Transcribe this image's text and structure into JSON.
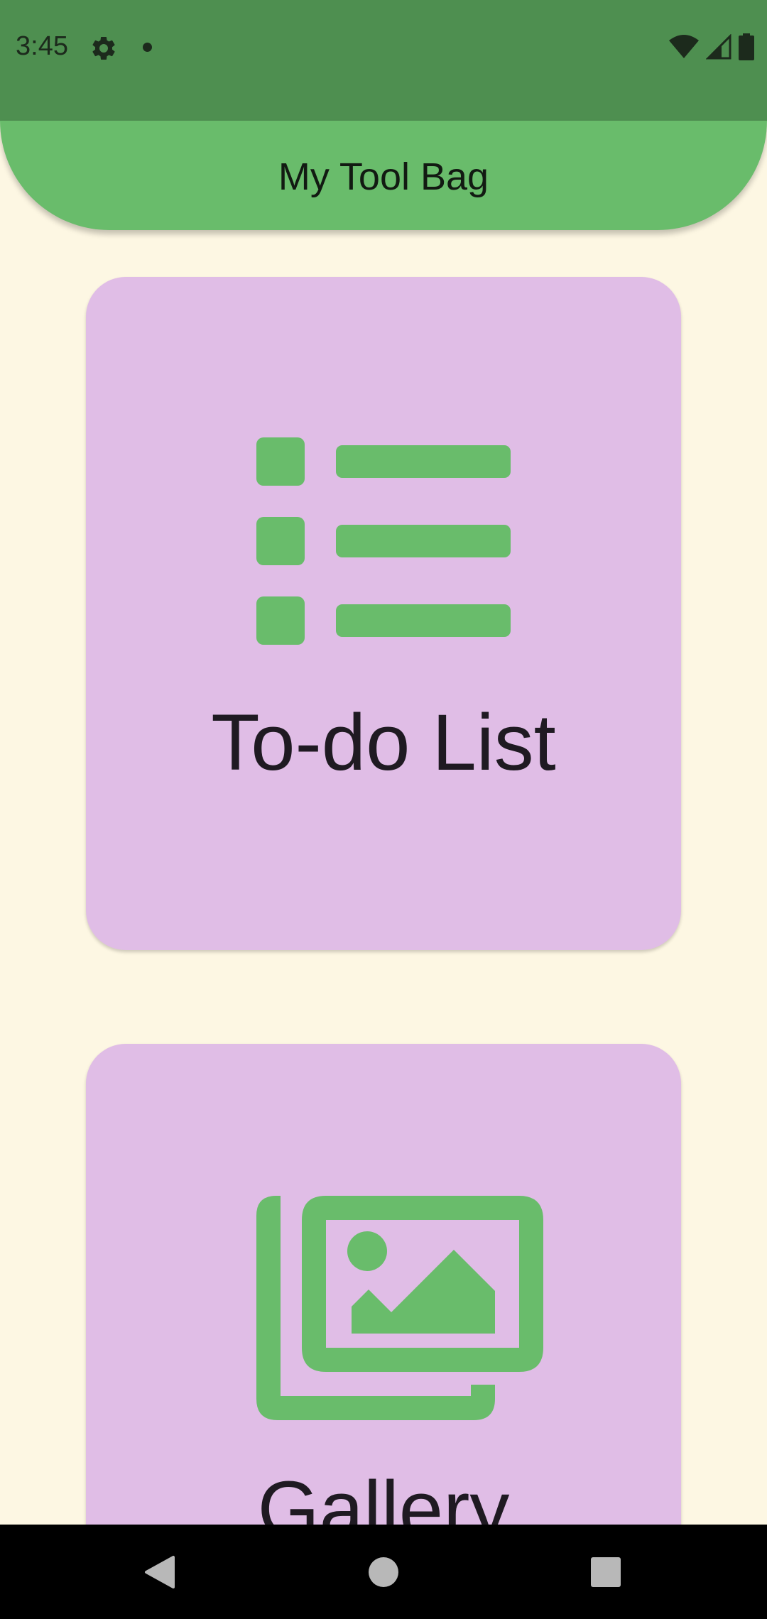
{
  "status_bar": {
    "time": "3:45",
    "settings_icon": "gear-icon",
    "notification_dot": "dot-icon",
    "wifi_icon": "wifi-icon",
    "signal_icon": "cell-signal-icon",
    "battery_icon": "battery-icon"
  },
  "app_bar": {
    "title": "My Tool Bag"
  },
  "cards": [
    {
      "label": "To-do List",
      "icon": "list-icon"
    },
    {
      "label": "Gallery",
      "icon": "photo-library-icon"
    }
  ],
  "nav_bar": {
    "back_icon": "back-triangle-icon",
    "home_icon": "home-circle-icon",
    "recents_icon": "recents-square-icon"
  },
  "colors": {
    "status_bar": "#4e8f50",
    "app_bar": "#69bc6b",
    "background": "#fdf7e3",
    "card": "#e0bde6",
    "icon": "#69bc6b",
    "text": "#1f1a22"
  }
}
